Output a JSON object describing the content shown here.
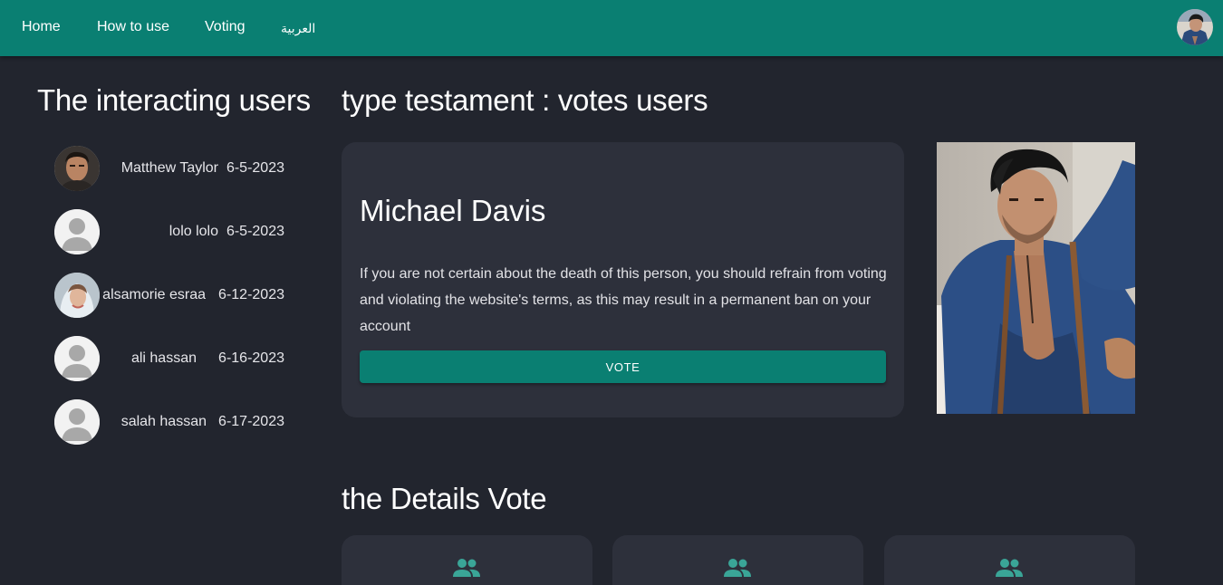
{
  "nav": {
    "links": [
      "Home",
      "How to use",
      "Voting",
      "العربية"
    ]
  },
  "sidebar": {
    "title": "The interacting users",
    "users": [
      {
        "name": "Matthew Taylor",
        "date": "6-5-2023",
        "avatar": "photo-man"
      },
      {
        "name": "lolo lolo",
        "date": "6-5-2023",
        "avatar": "default-avatar"
      },
      {
        "name": "alsamorie esraa",
        "date": "6-12-2023",
        "avatar": "photo-woman"
      },
      {
        "name": "ali hassan",
        "date": "6-16-2023",
        "avatar": "default-avatar"
      },
      {
        "name": "salah hassan",
        "date": "6-17-2023",
        "avatar": "default-avatar"
      }
    ]
  },
  "main": {
    "title": "type testament : votes users",
    "card": {
      "name": "Michael Davis",
      "text": "If you are not certain about the death of this person, you should refrain from voting and violating the website's terms, as this may result in a permanent ban on your account",
      "vote_label": "VOTE"
    },
    "details_title": "the Details Vote",
    "detail_cards": [
      {
        "icon": "users-icon"
      },
      {
        "icon": "users-icon"
      },
      {
        "icon": "users-icon"
      }
    ]
  },
  "colors": {
    "primary": "#0a7f72",
    "background": "#22252e",
    "card": "#2d303b",
    "icon_accent": "#3aa597"
  }
}
